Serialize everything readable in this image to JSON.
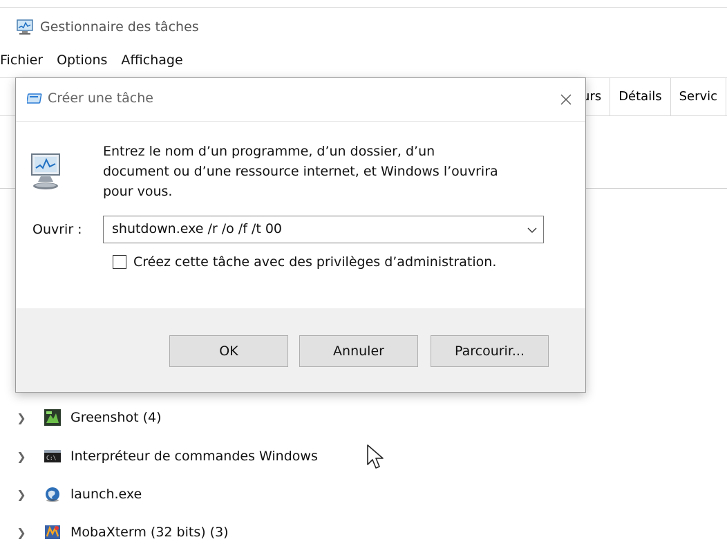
{
  "window": {
    "title": "Gestionnaire des tâches",
    "menu": [
      "Fichier",
      "Options",
      "Affichage"
    ],
    "tabs": [
      "urs",
      "Détails",
      "Servic"
    ]
  },
  "processes": [
    {
      "label": "Greenshot (4)",
      "icon": "greenshot-icon"
    },
    {
      "label": "Interpréteur de commandes Windows",
      "icon": "cmd-icon"
    },
    {
      "label": "launch.exe",
      "icon": "globe-icon"
    },
    {
      "label": "MobaXterm (32 bits) (3)",
      "icon": "mobaxterm-icon"
    }
  ],
  "dialog": {
    "title": "Créer une tâche",
    "message_lines": [
      "Entrez le nom d’un programme, d’un dossier, d’un",
      "document ou d’une ressource internet, et Windows l’ouvrira",
      "pour vous."
    ],
    "open_label": "Ouvrir :",
    "open_value": "shutdown.exe /r /o /f /t 00",
    "admin_checkbox": {
      "label": "Créez cette tâche avec des privilèges d’administration.",
      "checked": false
    },
    "buttons": {
      "ok": "OK",
      "cancel": "Annuler",
      "browse": "Parcourir..."
    }
  },
  "colors": {
    "accent": "#2a7bd5",
    "footer": "#f0f0f0",
    "button": "#e1e1e1"
  }
}
